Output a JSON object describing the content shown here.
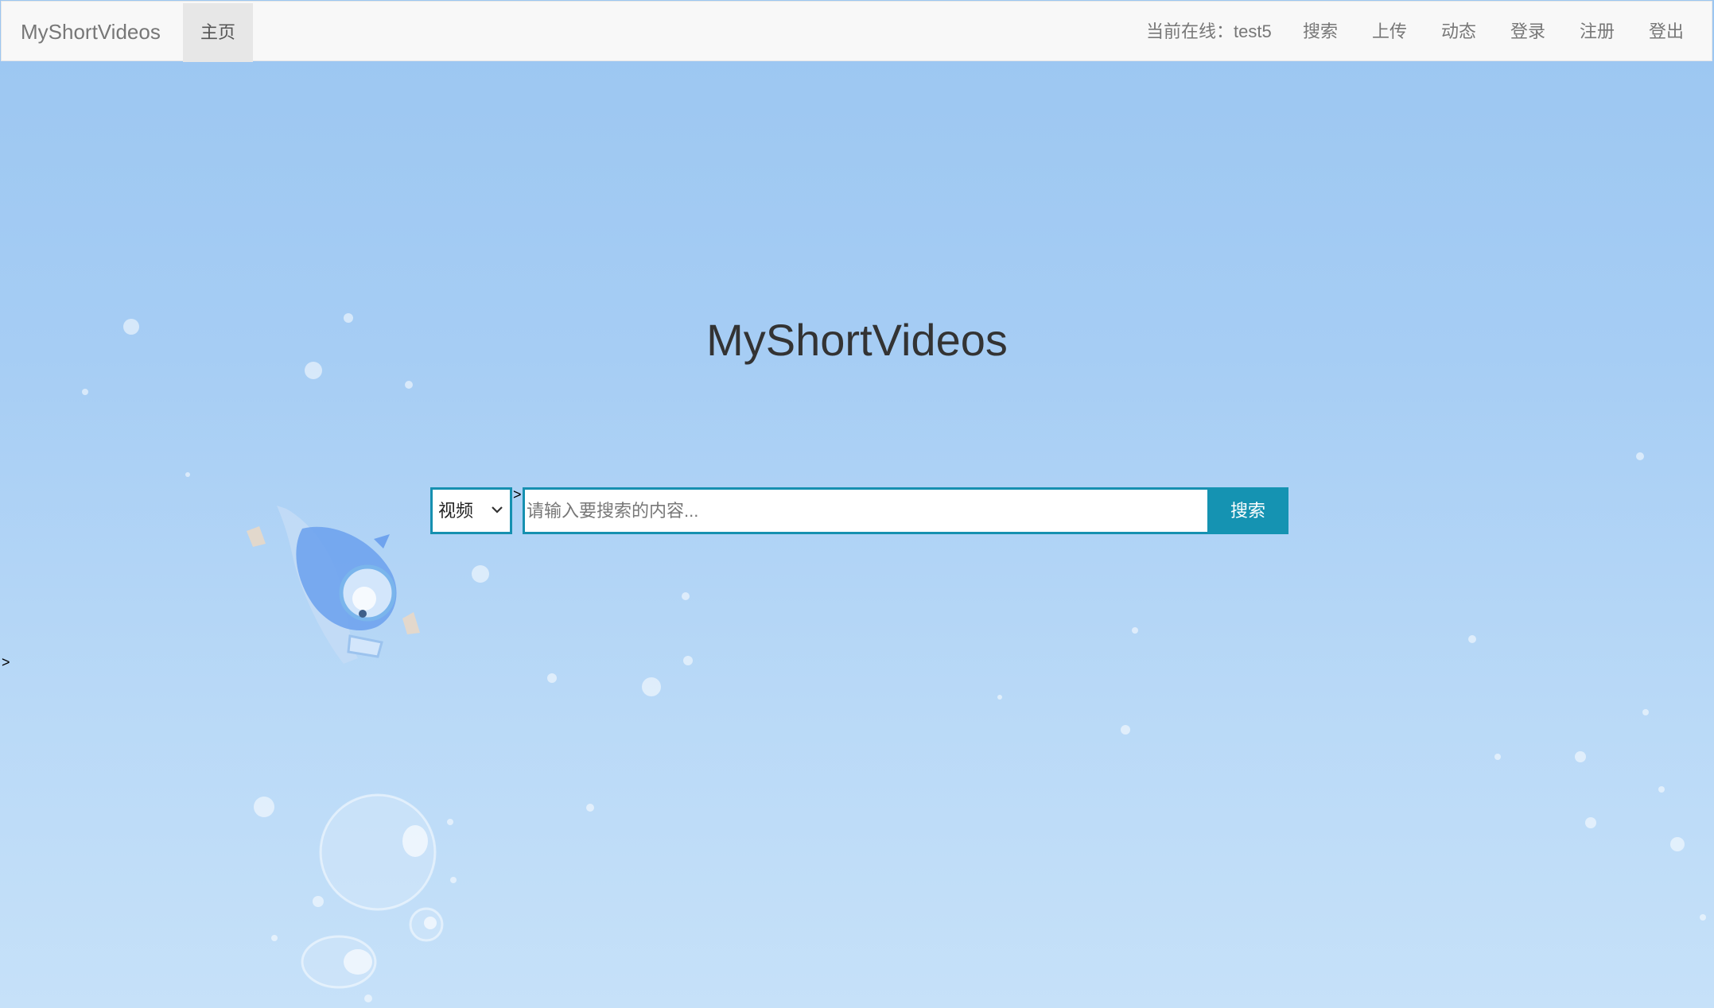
{
  "navbar": {
    "brand": "MyShortVideos",
    "home": "主页",
    "status": "当前在线：test5",
    "links": {
      "search": "搜索",
      "upload": "上传",
      "feed": "动态",
      "login": "登录",
      "register": "注册",
      "logout": "登出"
    }
  },
  "hero": {
    "title": "MyShortVideos"
  },
  "search": {
    "type_selected": "视频",
    "placeholder": "请输入要搜索的内容...",
    "button": "搜索"
  },
  "stray_marks": {
    "a": ">",
    "b": ">"
  },
  "colors": {
    "accent": "#1593b2",
    "navbar_bg": "#f8f8f8",
    "background_top": "#9bc6f1",
    "background_bottom": "#c6e1f9"
  }
}
